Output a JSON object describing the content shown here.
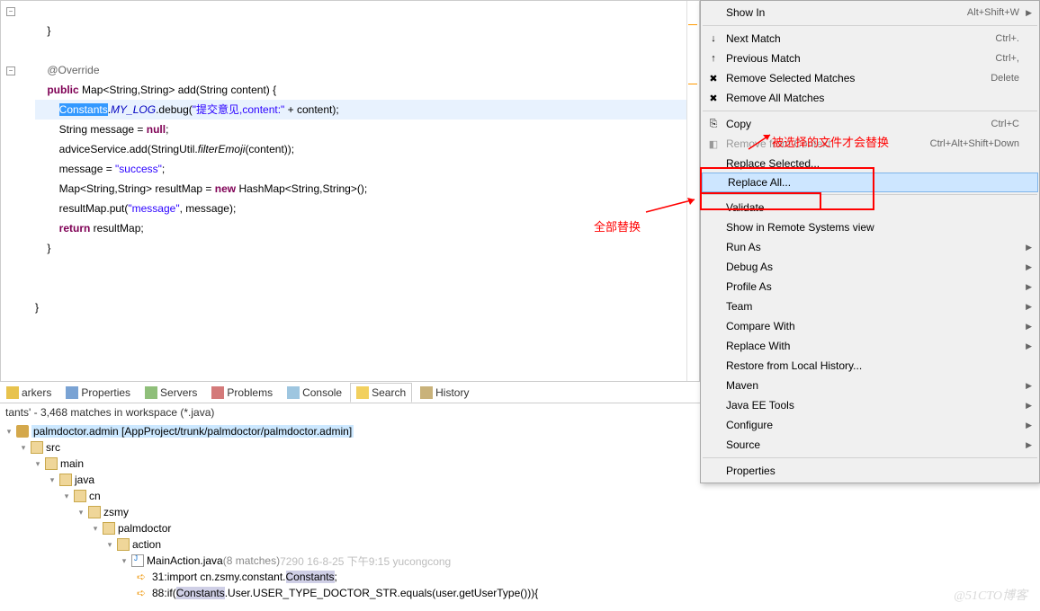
{
  "code": {
    "l1": "    }",
    "l2": "",
    "l3": "    @Override",
    "l4_pre": "    ",
    "l4_kw1": "public",
    "l4_mid": " Map<String,String> add(String content) {",
    "l5_pre": "        ",
    "l5_sel": "Constants",
    "l5_a": ".",
    "l5_field": "MY_LOG",
    "l5_b": ".debug(",
    "l5_str": "\"提交意见,content:\"",
    "l5_c": " + content);",
    "l6_pre": "        String message = ",
    "l6_kw": "null",
    "l6_post": ";",
    "l7_pre": "        adviceService.add(StringUtil.",
    "l7_it": "filterEmoji",
    "l7_post": "(content));",
    "l8_pre": "        message = ",
    "l8_str": "\"success\"",
    "l8_post": ";",
    "l9_pre": "        Map<String,String> resultMap = ",
    "l9_kw": "new",
    "l9_post": " HashMap<String,String>();",
    "l10_pre": "        resultMap.put(",
    "l10_str": "\"message\"",
    "l10_post": ", message);",
    "l11_pre": "        ",
    "l11_kw": "return",
    "l11_post": " resultMap;",
    "l12": "    }",
    "l13": "",
    "l14": "",
    "l15": "}"
  },
  "tabs": {
    "markers": "arkers",
    "properties": "Properties",
    "servers": "Servers",
    "problems": "Problems",
    "console": "Console",
    "search": "Search",
    "history": "History"
  },
  "search": {
    "summary": "tants' - 3,468 matches in workspace (*.java)",
    "project": "palmdoctor.admin [AppProject/trunk/palmdoctor/palmdoctor.admin]",
    "tree": [
      "src",
      "main",
      "java",
      "cn",
      "zsmy",
      "palmdoctor",
      "action"
    ],
    "file": "MainAction.java",
    "file_matches": "(8 matches)",
    "file_meta": "7290  16-8-25 下午9:15  yucongcong",
    "m1_line": "31:",
    "m1_a": " import cn.zsmy.constant.",
    "m1_hl": "Constants",
    "m1_b": ";",
    "m2_line": "88:",
    "m2_a": " if(",
    "m2_hl": "Constants",
    "m2_b": ".User.USER_TYPE_DOCTOR_STR.equals(user.getUserType())){"
  },
  "menu": {
    "show_in": "Show In",
    "show_in_sc": "Alt+Shift+W",
    "next": "Next Match",
    "next_sc": "Ctrl+.",
    "prev": "Previous Match",
    "prev_sc": "Ctrl+,",
    "rem_sel": "Remove Selected Matches",
    "rem_sel_sc": "Delete",
    "rem_all": "Remove All Matches",
    "copy": "Copy",
    "copy_sc": "Ctrl+C",
    "rem_ctx": "Remove from Context",
    "rem_ctx_sc": "Ctrl+Alt+Shift+Down",
    "rep_sel": "Replace Selected...",
    "rep_all": "Replace All...",
    "validate": "Validate",
    "remote": "Show in Remote Systems view",
    "run": "Run As",
    "debug": "Debug As",
    "profile": "Profile As",
    "team": "Team",
    "compare": "Compare With",
    "replace": "Replace With",
    "restore": "Restore from Local History...",
    "maven": "Maven",
    "jee": "Java EE Tools",
    "config": "Configure",
    "source": "Source",
    "props": "Properties"
  },
  "anno": {
    "sel_note": "被选择的文件才会替换",
    "all_note": "全部替换"
  },
  "watermark": "@51CTO博客"
}
